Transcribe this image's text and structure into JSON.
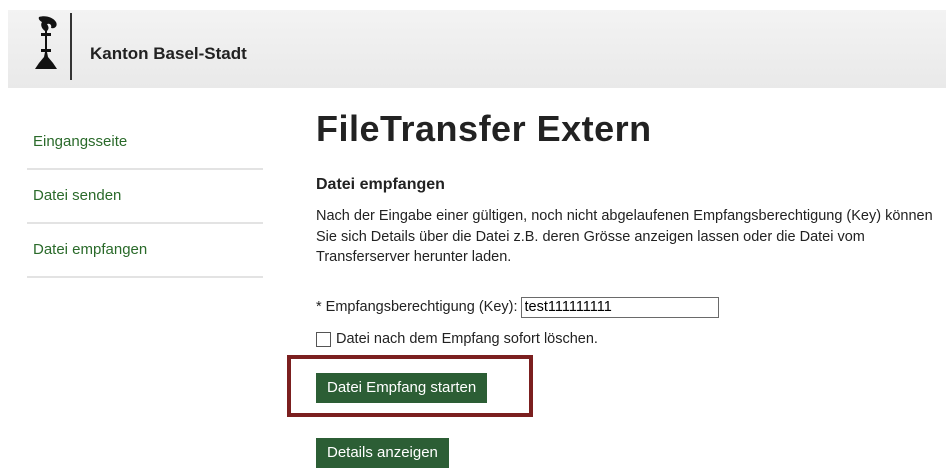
{
  "header": {
    "site_title": "Kanton Basel-Stadt"
  },
  "sidebar": {
    "items": [
      {
        "label": "Eingangsseite"
      },
      {
        "label": "Datei senden"
      },
      {
        "label": "Datei empfangen"
      }
    ]
  },
  "main": {
    "title": "FileTransfer Extern",
    "section_title": "Datei empfangen",
    "description": "Nach der Eingabe einer gültigen, noch nicht abgelaufenen Empfangsberechtigung (Key) können Sie sich Details über die Datei z.B. deren Grösse anzeigen lassen oder die Datei vom Transferserver herunter laden.",
    "key_label": "* Empfangsberechtigung (Key):",
    "key_value": "test111111111",
    "delete_checkbox_label": "Datei nach dem Empfang sofort löschen.",
    "delete_checked": false,
    "start_button": "Datei Empfang starten",
    "details_button": "Details anzeigen"
  },
  "colors": {
    "button_bg": "#2c5e35",
    "nav_link": "#2a6a2a",
    "highlight": "#7b1f1f"
  }
}
